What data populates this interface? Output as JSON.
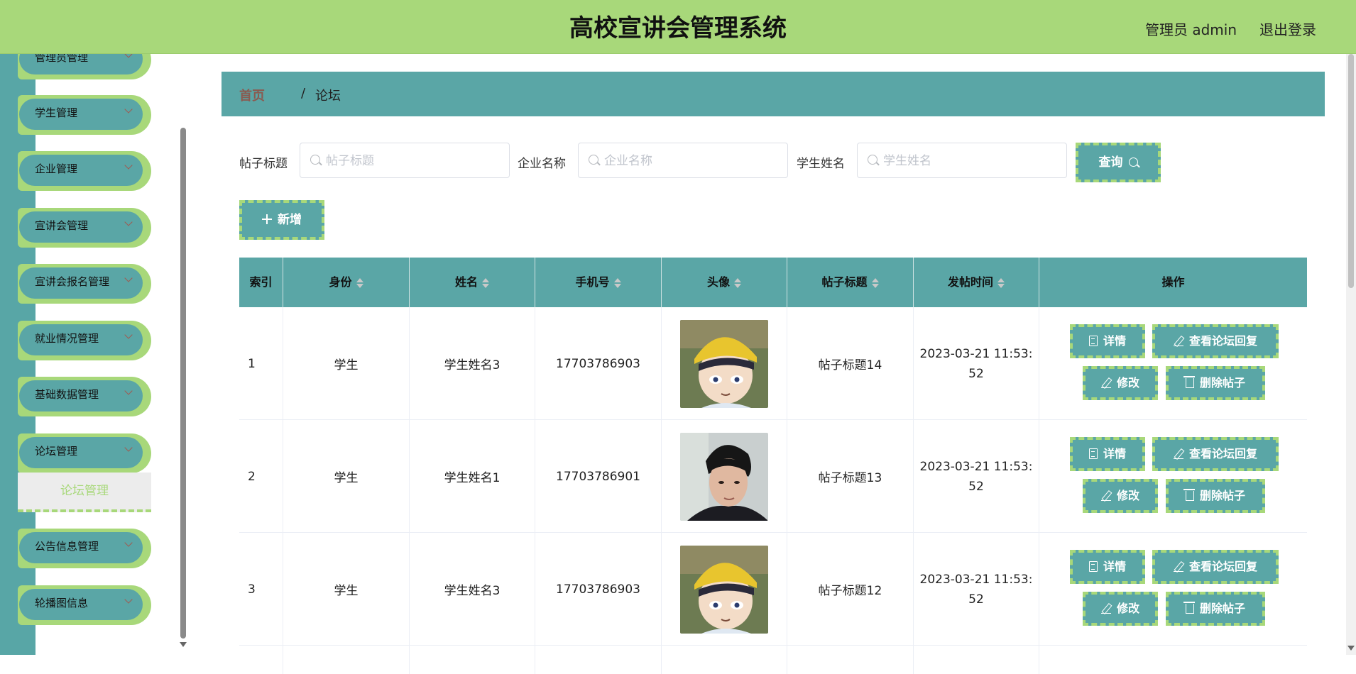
{
  "header": {
    "title": "高校宣讲会管理系统",
    "user": "管理员 admin",
    "logout": "退出登录"
  },
  "sidebar": {
    "items": [
      {
        "label": "管理员管理"
      },
      {
        "label": "学生管理"
      },
      {
        "label": "企业管理"
      },
      {
        "label": "宣讲会管理"
      },
      {
        "label": "宣讲会报名管理"
      },
      {
        "label": "就业情况管理"
      },
      {
        "label": "基础数据管理"
      },
      {
        "label": "论坛管理"
      },
      {
        "label": "公告信息管理"
      },
      {
        "label": "轮播图信息"
      }
    ],
    "active_sub": "论坛管理"
  },
  "breadcrumb": {
    "home": "首页",
    "separator": "/",
    "current": "论坛"
  },
  "filters": {
    "title_label": "帖子标题",
    "title_placeholder": "帖子标题",
    "company_label": "企业名称",
    "company_placeholder": "企业名称",
    "student_label": "学生姓名",
    "student_placeholder": "学生姓名",
    "query_button": "查询",
    "add_button": "新增"
  },
  "table": {
    "columns": [
      "索引",
      "身份",
      "姓名",
      "手机号",
      "头像",
      "帖子标题",
      "发帖时间",
      "操作"
    ],
    "rows": [
      {
        "index": "1",
        "role": "学生",
        "name": "学生姓名3",
        "phone": "17703786903",
        "avatar": "cartoon-avatar",
        "title": "帖子标题14",
        "time_line1": "2023-03-21 11:53:",
        "time_line2": "52"
      },
      {
        "index": "2",
        "role": "学生",
        "name": "学生姓名1",
        "phone": "17703786901",
        "avatar": "photo-avatar",
        "title": "帖子标题13",
        "time_line1": "2023-03-21 11:53:",
        "time_line2": "52"
      },
      {
        "index": "3",
        "role": "学生",
        "name": "学生姓名3",
        "phone": "17703786903",
        "avatar": "cartoon-avatar",
        "title": "帖子标题12",
        "time_line1": "2023-03-21 11:53:",
        "time_line2": "52"
      }
    ],
    "actions": {
      "detail": "详情",
      "view_replies": "查看论坛回复",
      "edit": "修改",
      "delete": "删除帖子"
    }
  },
  "colors": {
    "header_bg": "#a8d87a",
    "accent": "#5aa6a6",
    "dashed_border": "#a8d87a"
  }
}
